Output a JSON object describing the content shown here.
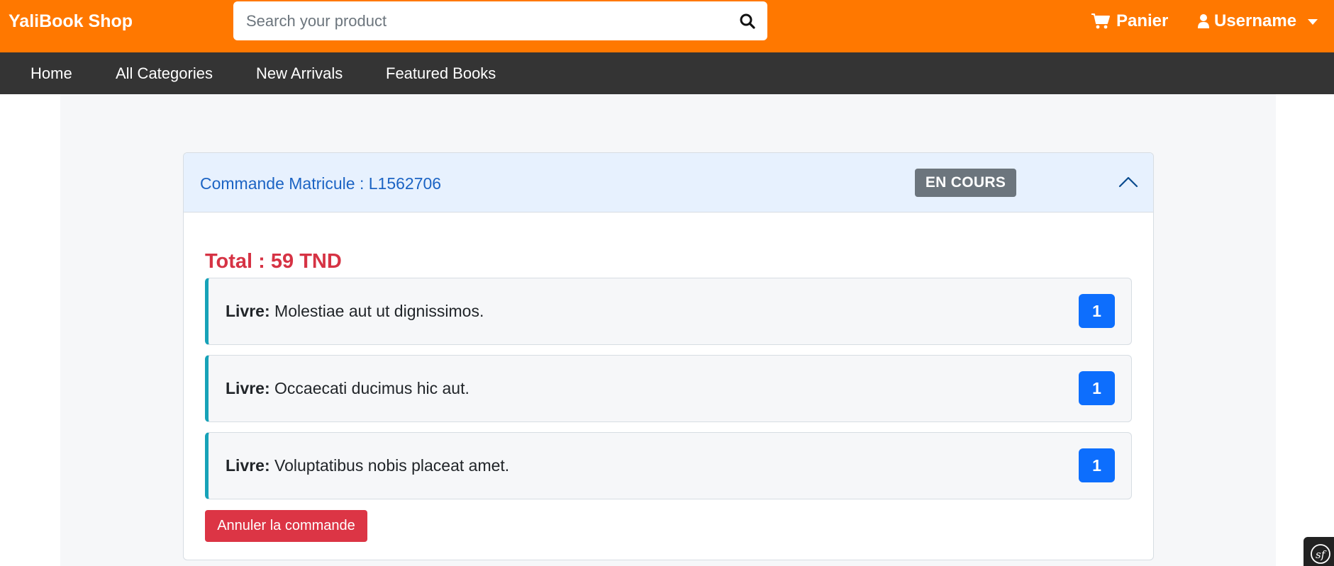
{
  "header": {
    "brand": "YaliBook Shop",
    "search_placeholder": "Search your product",
    "cart_label": "Panier",
    "user_label": "Username"
  },
  "nav": {
    "items": [
      "Home",
      "All Categories",
      "New Arrivals",
      "Featured Books"
    ]
  },
  "order": {
    "title": "Commande Matricule : L1562706",
    "status": "EN COURS",
    "total": "Total : 59 TND",
    "items": [
      {
        "prefix": "Livre:",
        "name": "Molestiae aut ut dignissimos.",
        "qty": "1"
      },
      {
        "prefix": "Livre:",
        "name": "Occaecati ducimus hic aut.",
        "qty": "1"
      },
      {
        "prefix": "Livre:",
        "name": "Voluptatibus nobis placeat amet.",
        "qty": "1"
      }
    ],
    "cancel_label": "Annuler la commande"
  },
  "colors": {
    "topbar": "#ff7800",
    "navbar": "#343434",
    "accent_blue": "#0d6efd",
    "danger": "#dc3545",
    "item_border": "#17a2b8"
  },
  "icons": {
    "search": "search-icon",
    "cart": "cart-icon",
    "user": "user-icon",
    "collapse": "chevron-up-icon",
    "dev_toolbar": "symfony-icon"
  }
}
